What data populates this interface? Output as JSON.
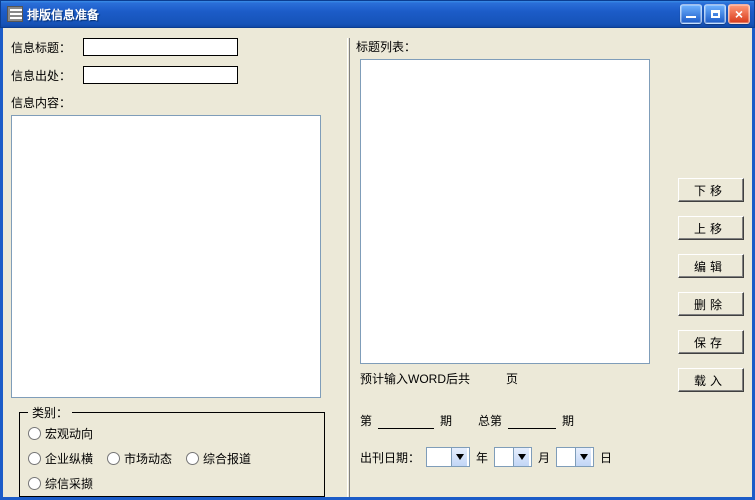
{
  "window": {
    "title": "排版信息准备"
  },
  "left": {
    "labels": {
      "infoTitle": "信息标题：",
      "infoSource": "信息出处：",
      "infoContent": "信息内容："
    },
    "values": {
      "infoTitle": "",
      "infoSource": "",
      "infoContent": ""
    },
    "category": {
      "legend": "类别：",
      "options": [
        {
          "label": "宏观动向",
          "checked": false
        },
        {
          "label": "企业纵横",
          "checked": false
        },
        {
          "label": "市场动态",
          "checked": false
        },
        {
          "label": "综合报道",
          "checked": false
        },
        {
          "label": "综信采撷",
          "checked": false
        }
      ]
    }
  },
  "right": {
    "titleListLabel": "标题列表：",
    "wordLine": {
      "prefix": "预计输入WORD后共",
      "count": "",
      "suffix": "页"
    },
    "buttons": {
      "down": "下移",
      "up": "上移",
      "edit": "编辑",
      "del": "删除",
      "save": "保存",
      "load": "载入"
    },
    "issue": {
      "prefix": "第",
      "midIssue": "期",
      "totalPrefix": "总第",
      "totalSuffix": "期",
      "issueNo": "",
      "totalNo": ""
    },
    "date": {
      "label": "出刊日期：",
      "yearUnit": "年",
      "monthUnit": "月",
      "dayUnit": "日",
      "year": "",
      "month": "",
      "day": ""
    }
  }
}
